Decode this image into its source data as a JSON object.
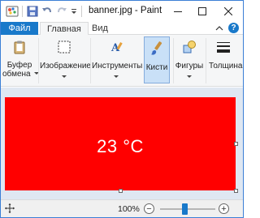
{
  "window": {
    "title": "banner.jpg - Paint"
  },
  "tabs": {
    "file": "Файл",
    "home": "Главная",
    "view": "Вид"
  },
  "ribbon": {
    "clipboard_line1": "Буфер",
    "clipboard_line2": "обмена",
    "image": "Изображение",
    "tools": "Инструменты",
    "brushes": "Кисти",
    "shapes": "Фигуры",
    "size": "Толщина"
  },
  "canvas": {
    "text": "23 °C",
    "background_color": "#ff0000"
  },
  "status": {
    "zoom": "100%",
    "zoom_fraction": 0.45
  },
  "colors": {
    "accent": "#1979ca",
    "ribbon_bg": "#f5f6f7",
    "workspace_bg": "#dfe7f2"
  }
}
